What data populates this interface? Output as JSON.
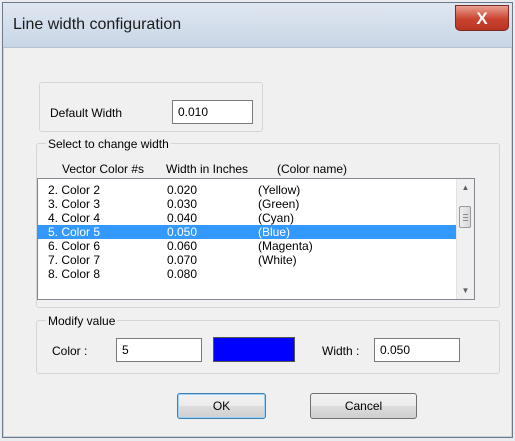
{
  "window": {
    "title": "Line width configuration",
    "close_label": "X"
  },
  "default_width": {
    "label": "Default Width",
    "value": "0.010"
  },
  "selection": {
    "group_label": "Select to change width",
    "headers": [
      "Vector Color #s",
      "Width in Inches",
      "(Color name)"
    ],
    "rows": [
      {
        "color": "2. Color  2",
        "width": "0.020",
        "name": "(Yellow)"
      },
      {
        "color": "3. Color  3",
        "width": "0.030",
        "name": "(Green)"
      },
      {
        "color": "4. Color  4",
        "width": "0.040",
        "name": "(Cyan)"
      },
      {
        "color": "5. Color  5",
        "width": "0.050",
        "name": "(Blue)"
      },
      {
        "color": "6. Color  6",
        "width": "0.060",
        "name": "(Magenta)"
      },
      {
        "color": "7. Color  7",
        "width": "0.070",
        "name": "(White)"
      },
      {
        "color": "8. Color  8",
        "width": "0.080",
        "name": ""
      }
    ],
    "selected_index": 3
  },
  "modify": {
    "group_label": "Modify value",
    "color_label": "Color :",
    "color_value": "5",
    "swatch_color": "#0000ff",
    "width_label": "Width :",
    "width_value": "0.050"
  },
  "buttons": {
    "ok": "OK",
    "cancel": "Cancel"
  },
  "colors": {
    "selection": "#3399ff",
    "close_button": "#c9432f"
  }
}
